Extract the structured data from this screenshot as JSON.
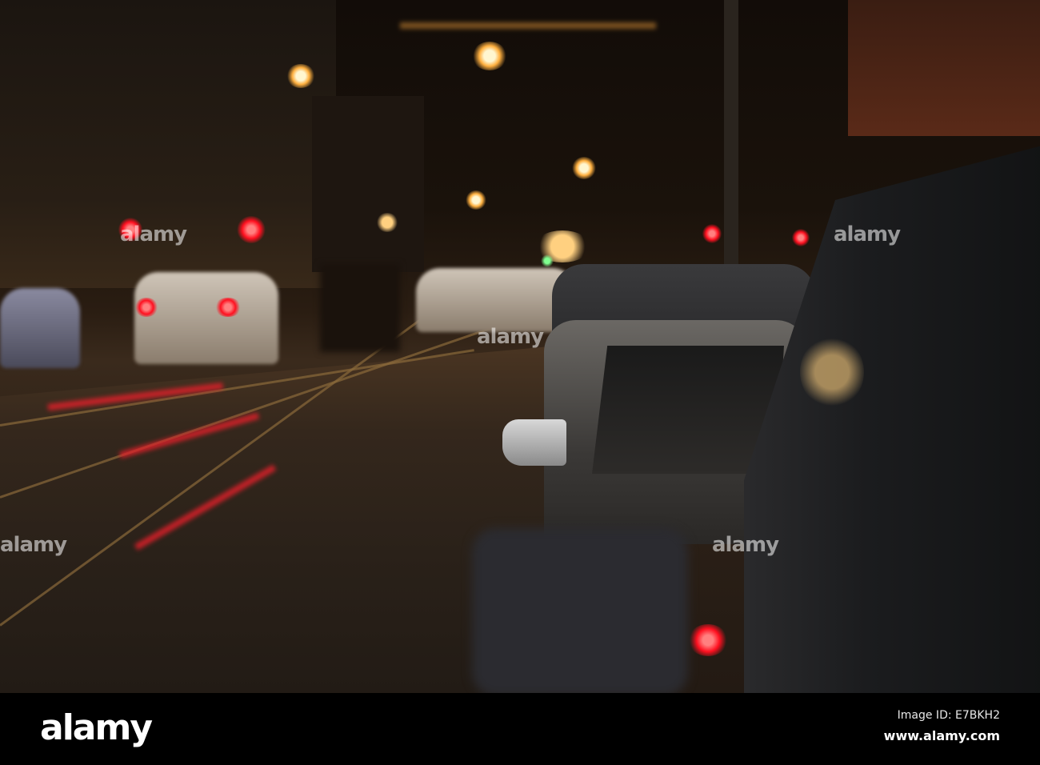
{
  "watermark": {
    "text": "alamy"
  },
  "footer": {
    "logo": "alamy",
    "image_id": "Image ID: E7BKH2",
    "website": "www.alamy.com"
  }
}
